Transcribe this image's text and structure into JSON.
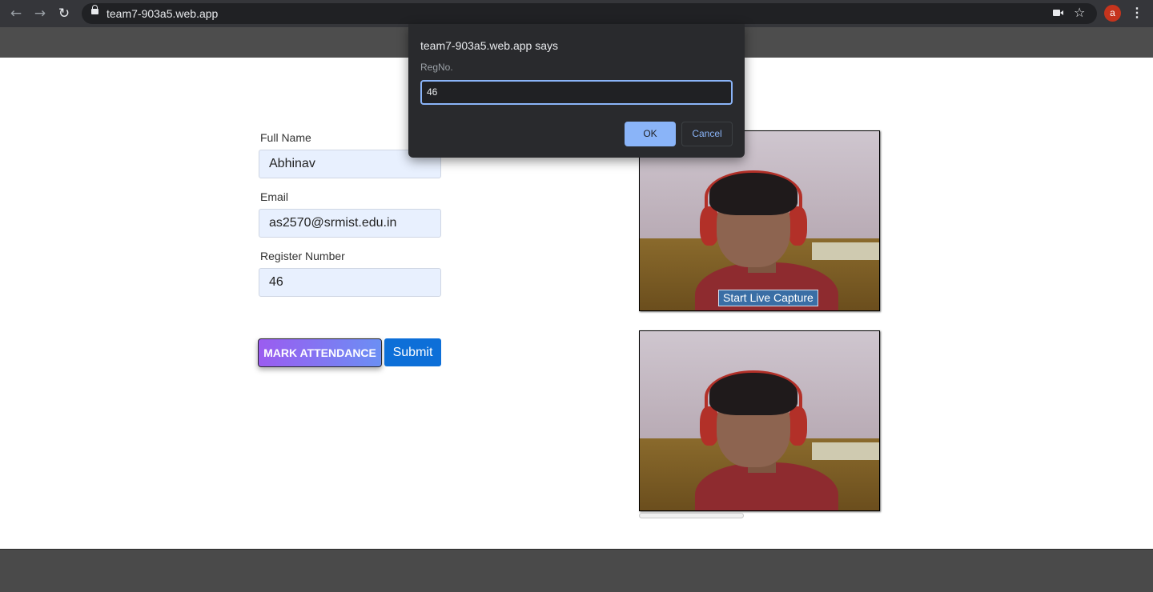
{
  "browser": {
    "url": "team7-903a5.web.app",
    "back_icon": "←",
    "forward_icon": "→",
    "reload_icon": "↻",
    "star_icon": "☆",
    "menu_icon": "⋮",
    "avatar_letter": "a",
    "avatar_color": "#c5341d"
  },
  "form": {
    "full_name_label": "Full Name",
    "full_name_value": "Abhinav",
    "email_label": "Email",
    "email_value": "as2570@srmist.edu.in",
    "register_label": "Register Number",
    "register_value": "46",
    "mark_attendance_label": "MARK ATTENDANCE",
    "submit_label": "Submit"
  },
  "camera": {
    "live_capture_label": "Start Live Capture"
  },
  "dialog": {
    "title": "team7-903a5.web.app says",
    "message": "RegNo.",
    "input_value": "46",
    "ok_label": "OK",
    "cancel_label": "Cancel"
  },
  "colors": {
    "submit": "#0d6fd8",
    "mark_gradient_start": "#9b5cf0",
    "mark_gradient_end": "#6b8ff4",
    "dialog_accent": "#8ab4f8"
  }
}
